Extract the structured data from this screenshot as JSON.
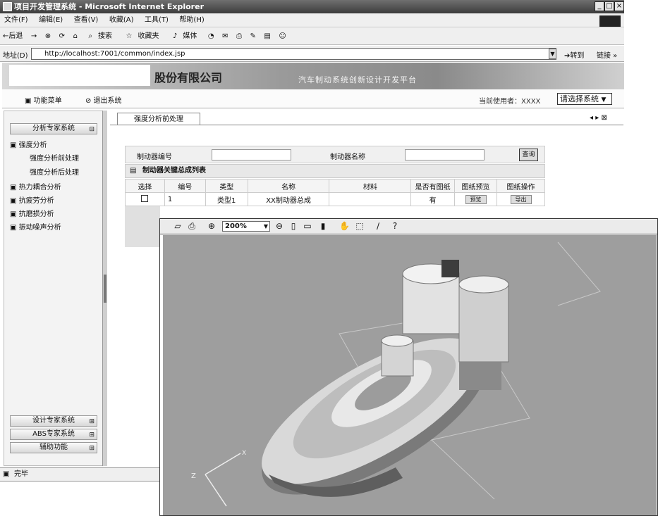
{
  "window": {
    "title": "项目开发管理系统 - Microsoft Internet Explorer",
    "controls": [
      "_",
      "□",
      "×"
    ]
  },
  "menubar": [
    "文件(F)",
    "编辑(E)",
    "查看(V)",
    "收藏(A)",
    "工具(T)",
    "帮助(H)"
  ],
  "toolbar": {
    "back": "←后退",
    "forward": "→",
    "search": "搜索",
    "favorites": "收藏夹",
    "media": "媒体"
  },
  "address": {
    "label": "地址(D)",
    "url": "http://localhost:7001/common/index.jsp",
    "go": "转到",
    "links": "链接 »"
  },
  "header": {
    "company": "股份有限公司",
    "platform": "汽车制动系统创新设计开发平台"
  },
  "appbar": {
    "function_menu": "功能菜单",
    "logout": "退出系统",
    "current_user": "当前使用者：XXXX",
    "system_select": "请选择系统"
  },
  "sidebar": {
    "top_section": "分析专家系统",
    "strength": "强度分析",
    "strength_pre": "强度分析前处理",
    "strength_post": "强度分析后处理",
    "thermal": "热力耦合分析",
    "fatigue": "抗疲劳分析",
    "wear": "抗磨损分析",
    "vibration": "振动噪声分析",
    "bottom_sections": [
      "设计专家系统",
      "ABS专家系统",
      "辅助功能"
    ]
  },
  "main": {
    "tab": "强度分析前处理",
    "brake_no_label": "制动器编号",
    "brake_name_label": "制动器名称",
    "query": "查询",
    "list_title": "制动器关键总成列表",
    "columns": [
      "选择",
      "编号",
      "类型",
      "名称",
      "材料",
      "是否有图纸",
      "图纸预览",
      "图纸操作"
    ],
    "row": {
      "id": "1",
      "type": "类型1",
      "name": "XX制动器总成",
      "material": "",
      "has_drawing": "有",
      "preview": "预览",
      "operation": "导出"
    }
  },
  "viewer": {
    "zoom": "200%"
  },
  "status": "完毕"
}
